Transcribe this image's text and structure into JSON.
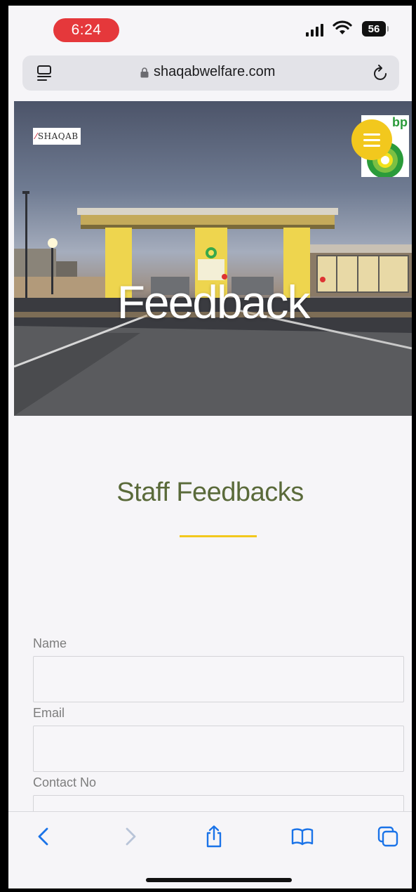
{
  "status_bar": {
    "time": "6:24",
    "battery": "56",
    "time_pill_color": "#e5383b"
  },
  "browser": {
    "url": "shaqabwelfare.com"
  },
  "hero": {
    "title": "Feedback",
    "brand_logo_text": "SHAQAB",
    "partner_logo_text": "bp"
  },
  "main": {
    "section_title": "Staff Feedbacks",
    "accent_color": "#f2c81d",
    "title_color": "#5a6a3a"
  },
  "form": {
    "fields": [
      {
        "label": "Name",
        "value": ""
      },
      {
        "label": "Email",
        "value": ""
      },
      {
        "label": "Contact No",
        "value": ""
      }
    ]
  },
  "toolbar": {
    "icons": [
      "back-icon",
      "forward-icon",
      "share-icon",
      "bookmarks-icon",
      "tabs-icon"
    ]
  }
}
